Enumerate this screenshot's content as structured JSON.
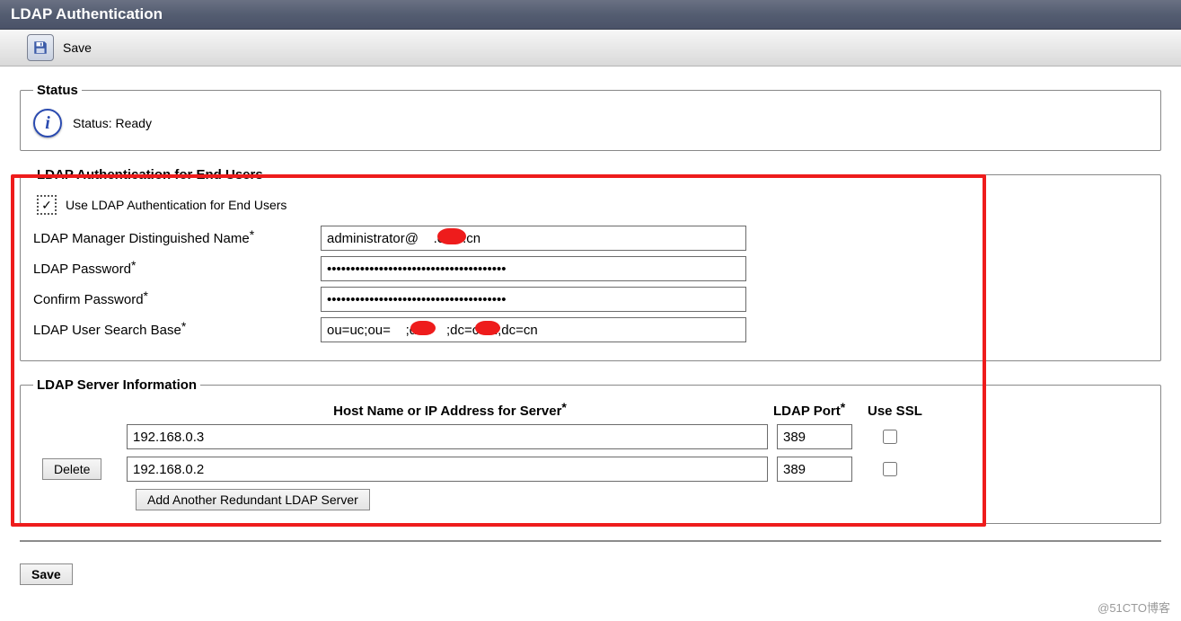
{
  "page_title": "LDAP Authentication",
  "toolbar": {
    "save_label": "Save"
  },
  "status_section": {
    "legend": "Status",
    "text": "Status: Ready"
  },
  "auth_section": {
    "legend": "LDAP Authentication for End Users",
    "use_ldap_label": "Use LDAP Authentication for End Users",
    "use_ldap_checked": true,
    "manager_dn_label": "LDAP Manager Distinguished Name",
    "manager_dn_value": "administrator@    .com.cn",
    "password_label": "LDAP Password",
    "password_value": "••••••••••••••••••••••••••••••••••••••",
    "confirm_label": "Confirm Password",
    "confirm_value": "••••••••••••••••••••••••••••••••••••••",
    "search_base_label": "LDAP User Search Base",
    "search_base_value": "ou=uc;ou=    ;dc=    ;dc=com;dc=cn"
  },
  "server_section": {
    "legend": "LDAP Server Information",
    "columns": {
      "host": "Host Name or IP Address for Server",
      "port": "LDAP Port",
      "ssl": "Use SSL"
    },
    "rows": [
      {
        "host": "192.168.0.3",
        "port": "389",
        "ssl": false,
        "deletable": false
      },
      {
        "host": "192.168.0.2",
        "port": "389",
        "ssl": false,
        "deletable": true
      }
    ],
    "delete_label": "Delete",
    "add_button": "Add Another Redundant LDAP Server"
  },
  "bottom": {
    "save_label": "Save"
  },
  "watermark": "@51CTO博客"
}
